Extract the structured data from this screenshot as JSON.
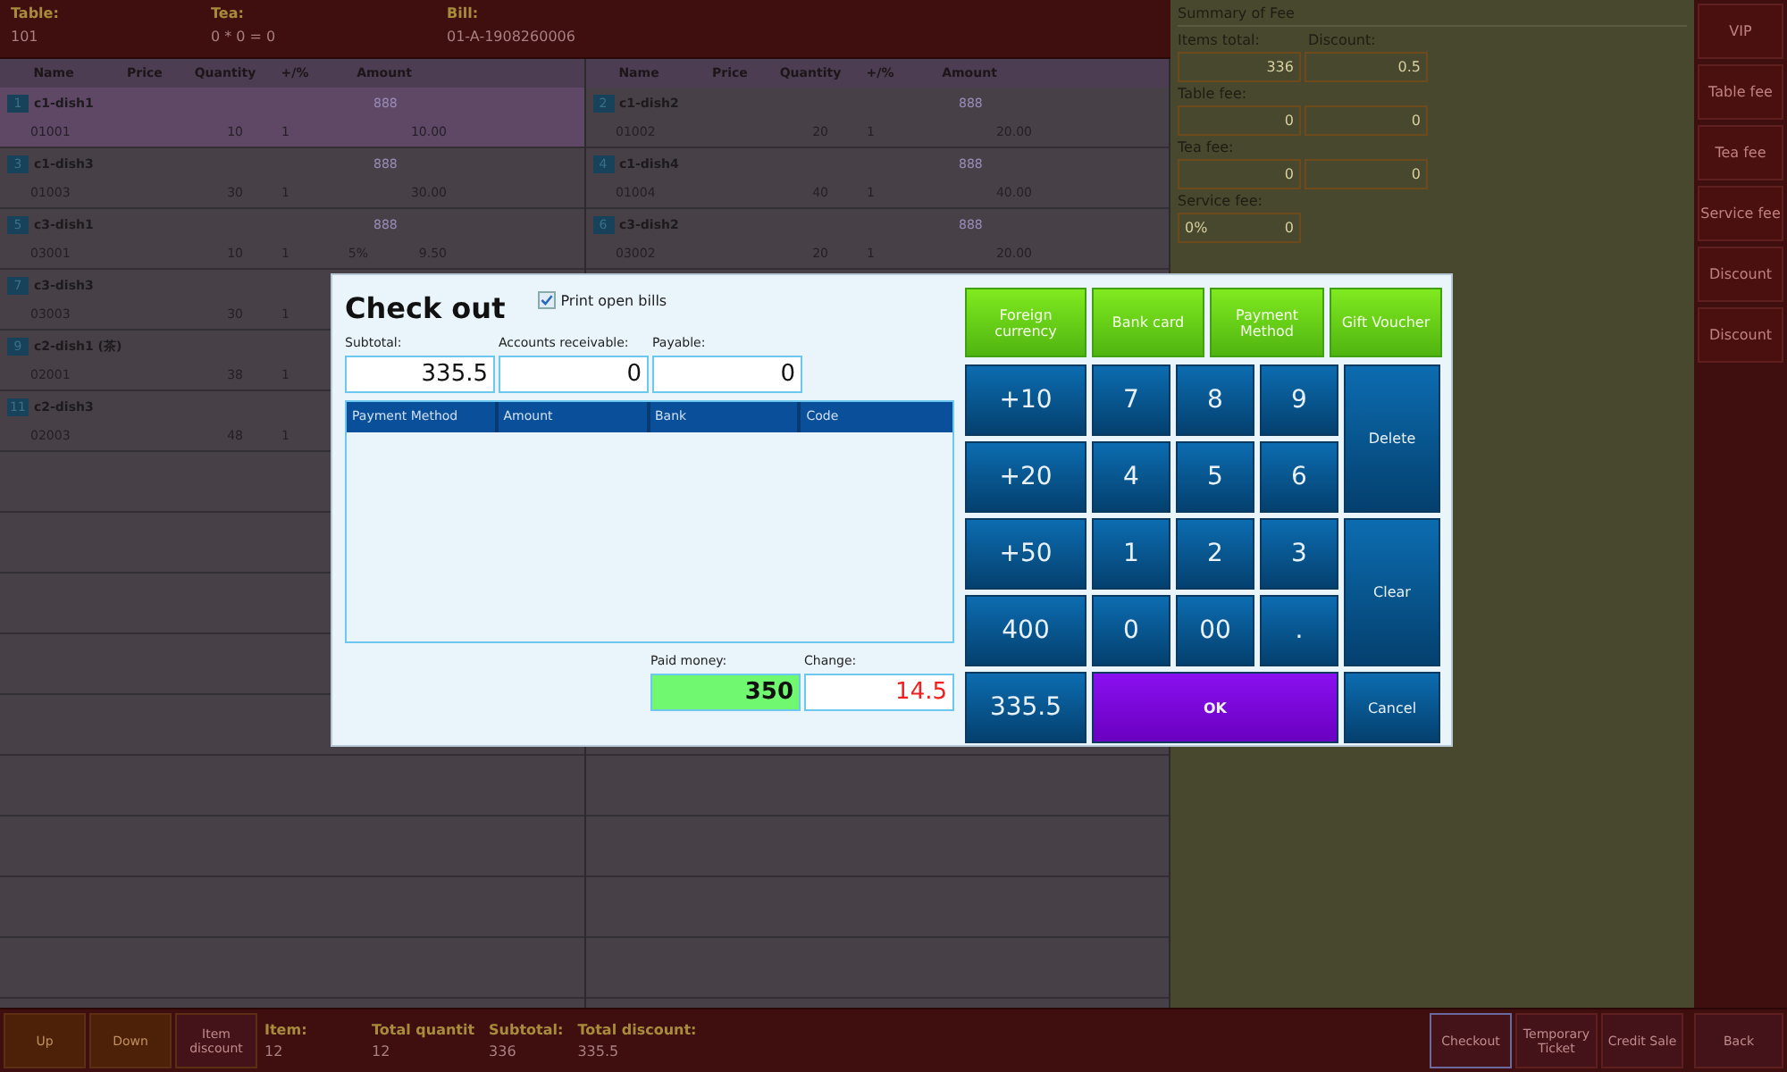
{
  "header": {
    "fields": [
      {
        "label": "Table:",
        "value": "101"
      },
      {
        "label": "Tea:",
        "value": "0 * 0 = 0"
      },
      {
        "label": "Bill:",
        "value": "01-A-1908260006"
      }
    ]
  },
  "order_lists": [
    {
      "columns": [
        "Name",
        "Price",
        "Quantity",
        "+/%",
        "Amount"
      ],
      "rows": [
        {
          "number": "1",
          "name": "c1-dish1",
          "tag": "888",
          "code": "01001",
          "price": "10",
          "quantity": "1",
          "amount": "10.00",
          "selected": true
        },
        {
          "number": "3",
          "name": "c1-dish3",
          "tag": "888",
          "code": "01003",
          "price": "30",
          "quantity": "1",
          "amount": "30.00",
          "selected": false
        },
        {
          "number": "5",
          "name": "c3-dish1",
          "tag": "888",
          "code": "03001",
          "price": "10",
          "quantity": "1",
          "adjust": "5%",
          "amount": "9.50",
          "selected": false
        },
        {
          "number": "7",
          "name": "c3-dish3",
          "code": "03003",
          "price": "30",
          "quantity": "1",
          "selected": false
        },
        {
          "number": "9",
          "name": "c2-dish1 (茶)",
          "code": "02001",
          "price": "38",
          "quantity": "1",
          "selected": false
        },
        {
          "number": "11",
          "name": "c2-dish3",
          "code": "02003",
          "price": "48",
          "quantity": "1",
          "selected": false
        }
      ]
    },
    {
      "columns": [
        "Name",
        "Price",
        "Quantity",
        "+/%",
        "Amount"
      ],
      "rows": [
        {
          "number": "2",
          "name": "c1-dish2",
          "tag": "888",
          "code": "01002",
          "price": "20",
          "quantity": "1",
          "amount": "20.00",
          "selected": false
        },
        {
          "number": "4",
          "name": "c1-dish4",
          "tag": "888",
          "code": "01004",
          "price": "40",
          "quantity": "1",
          "amount": "40.00",
          "selected": false
        },
        {
          "number": "6",
          "name": "c3-dish2",
          "tag": "888",
          "code": "03002",
          "price": "20",
          "quantity": "1",
          "amount": "20.00",
          "selected": false
        }
      ]
    }
  ],
  "summary": {
    "title": "Summary of Fee",
    "groups": [
      {
        "labels": [
          "Items total:",
          "Discount:"
        ],
        "fields": [
          {
            "value": "336"
          },
          {
            "value": "0.5"
          }
        ]
      },
      {
        "labels": [
          "Table fee:"
        ],
        "fields": [
          {
            "value": "0"
          },
          {
            "value": "0"
          }
        ]
      },
      {
        "labels": [
          "Tea fee:"
        ],
        "fields": [
          {
            "value": "0"
          },
          {
            "value": "0"
          }
        ]
      },
      {
        "labels": [
          "Service fee:"
        ],
        "fields": [
          {
            "prefix": "0%",
            "value": "0"
          }
        ]
      }
    ]
  },
  "side_buttons": [
    "VIP",
    "Table fee",
    "Tea fee",
    "Service fee",
    "Discount",
    "Discount"
  ],
  "bottom_bar": {
    "left_buttons": [
      "Up",
      "Down",
      "Item discount"
    ],
    "stats": [
      {
        "label": "Item:",
        "value": "12"
      },
      {
        "label": "Total quantit",
        "value": "12"
      },
      {
        "label": "Subtotal:",
        "value": "336"
      },
      {
        "label": "Total discount:",
        "value": "335.5"
      }
    ],
    "right_buttons": [
      {
        "label": "Checkout",
        "selected": true
      },
      {
        "label": "Temporary Ticket",
        "selected": false
      },
      {
        "label": "Credit Sale",
        "selected": false
      },
      {
        "label": "Back",
        "selected": false
      }
    ]
  },
  "checkout": {
    "title": "Check out",
    "print_open_bills": {
      "label": "Print open bills",
      "checked": true
    },
    "amounts": [
      {
        "label": "Subtotal:",
        "value": "335.5"
      },
      {
        "label": "Accounts receivable:",
        "value": "0"
      },
      {
        "label": "Payable:",
        "value": "0"
      }
    ],
    "payments_table": {
      "columns": [
        "Payment Method",
        "Amount",
        "Bank",
        "Code"
      ]
    },
    "paid": {
      "label": "Paid money:",
      "value": "350"
    },
    "change": {
      "label": "Change:",
      "value": "14.5"
    },
    "payment_buttons": [
      "Foreign currency",
      "Bank card",
      "Payment Method",
      "Gift Voucher"
    ],
    "keys": [
      {
        "label": "+10",
        "kind": "amount"
      },
      {
        "label": "7",
        "kind": "digit"
      },
      {
        "label": "8",
        "kind": "digit"
      },
      {
        "label": "9",
        "kind": "digit"
      },
      {
        "label": "Delete",
        "kind": "tall"
      },
      {
        "label": "+20",
        "kind": "amount"
      },
      {
        "label": "4",
        "kind": "digit"
      },
      {
        "label": "5",
        "kind": "digit"
      },
      {
        "label": "6",
        "kind": "digit"
      },
      {
        "label": "+50",
        "kind": "amount"
      },
      {
        "label": "1",
        "kind": "digit"
      },
      {
        "label": "2",
        "kind": "digit"
      },
      {
        "label": "3",
        "kind": "digit"
      },
      {
        "label": "Clear",
        "kind": "tall"
      },
      {
        "label": "400",
        "kind": "amount"
      },
      {
        "label": "0",
        "kind": "digit"
      },
      {
        "label": "00",
        "kind": "digit"
      },
      {
        "label": ".",
        "kind": "digit"
      },
      {
        "label": "335.5",
        "kind": "amount"
      },
      {
        "label": "OK",
        "kind": "ok"
      },
      {
        "label": "Cancel",
        "kind": "action"
      }
    ]
  }
}
